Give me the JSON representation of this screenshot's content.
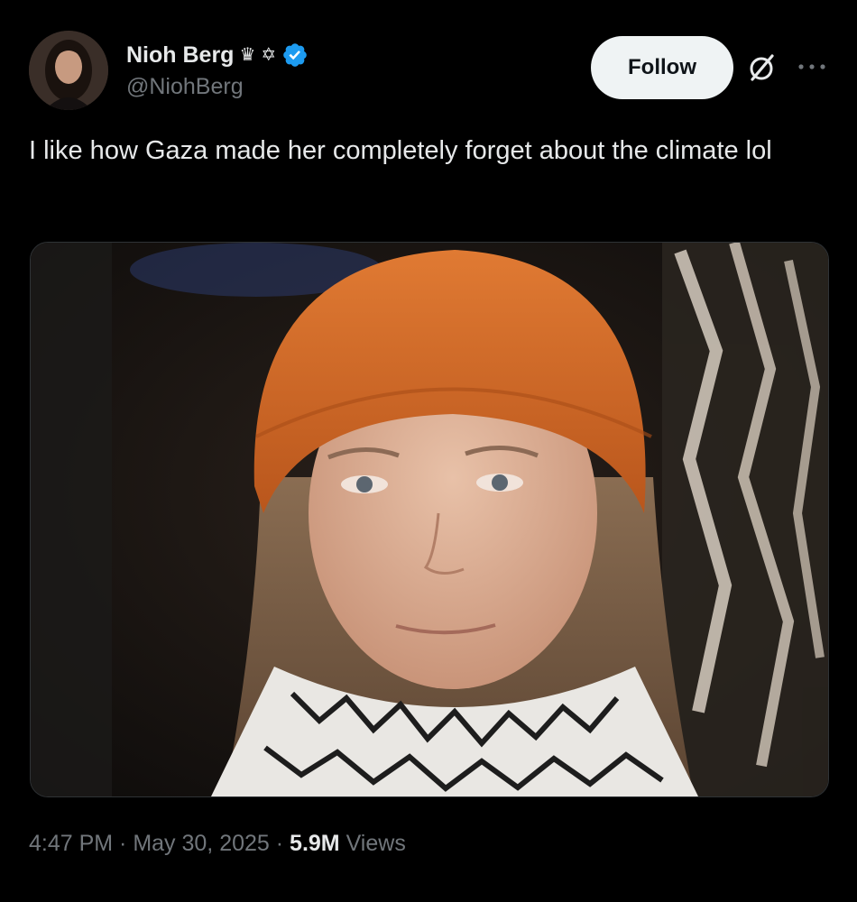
{
  "author": {
    "display_name": "Nioh Berg",
    "handle": "@NiohBerg",
    "name_badges": [
      "♛",
      "✡"
    ]
  },
  "actions": {
    "follow_label": "Follow"
  },
  "tweet": {
    "text": "I like how Gaza made her completely forget about the climate lol"
  },
  "meta": {
    "time": "4:47 PM",
    "separator": " · ",
    "date": "May 30, 2025",
    "views_count": "5.9M",
    "views_label": " Views"
  },
  "colors": {
    "background": "#000000",
    "text_primary": "#e7e9ea",
    "text_secondary": "#71767b",
    "verified_blue": "#1d9bf0",
    "follow_bg": "#eff3f4",
    "beanie_orange": "#d0692b"
  },
  "icons": {
    "verified": "verified-badge-icon",
    "grok": "grok-icon",
    "more": "more-options-icon"
  }
}
